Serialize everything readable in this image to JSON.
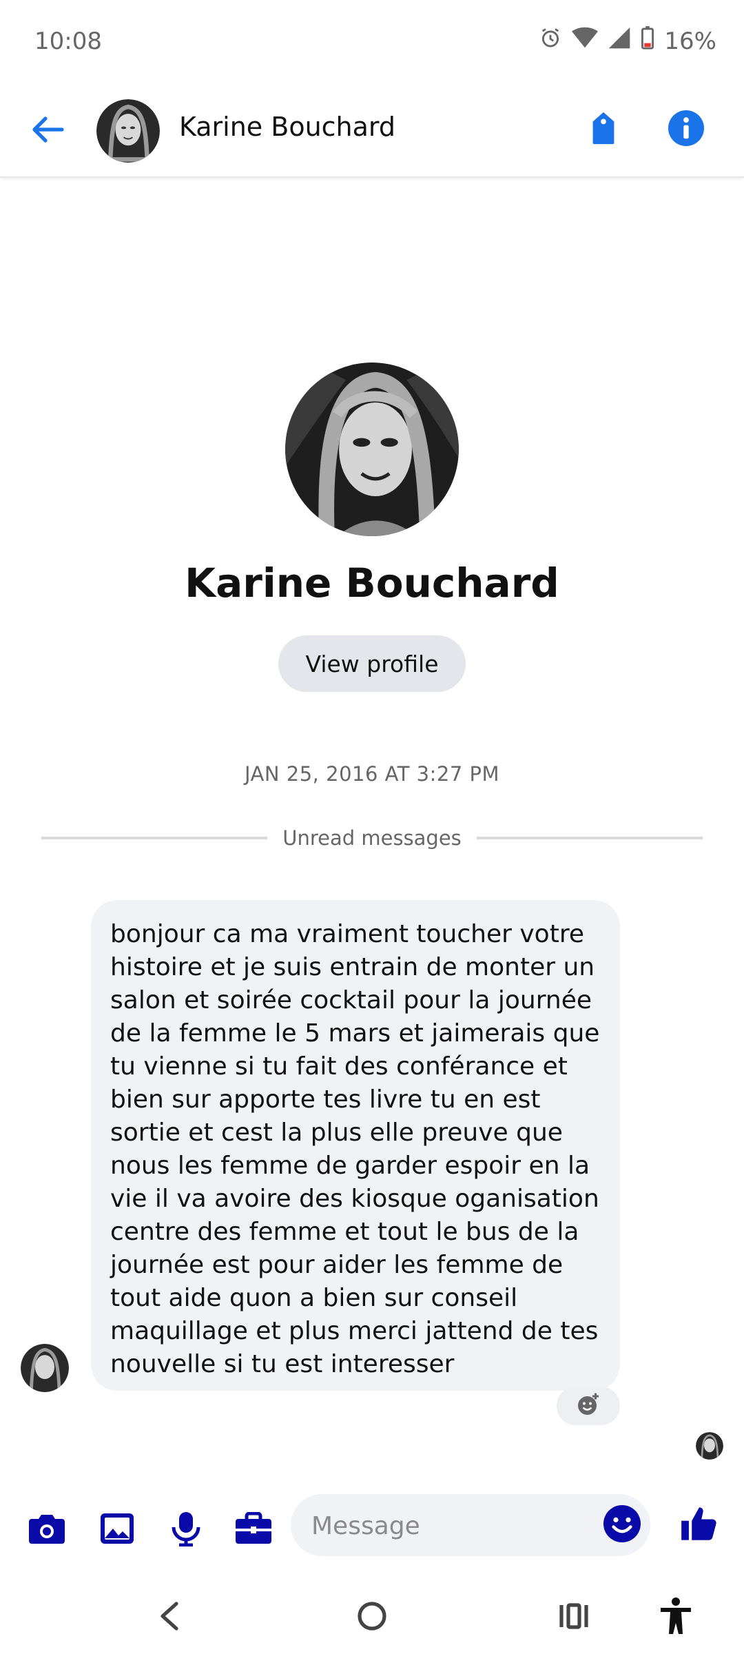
{
  "status": {
    "time": "10:08",
    "battery": "16%"
  },
  "header": {
    "name": "Karine Bouchard"
  },
  "profile": {
    "name": "Karine Bouchard",
    "view_profile_label": "View profile"
  },
  "conversation": {
    "date_label": "JAN 25, 2016 AT 3:27 PM",
    "unread_label": "Unread messages",
    "message": "bonjour ca ma  vraiment toucher votre\nhistoire et je suis entrain de monter un\nsalon et soirée cocktail pour la journée\nde la femme le 5 mars et jaimerais que\ntu vienne  si tu fait des conférance et\nbien sur  apporte tes livre tu  en est\nsortie et cest la plus elle preuve  que\nnous les femme de garder espoir en la\nvie il va avoire  des kiosque oganisation\ncentre des femme et tout le bus de la\njournée est pour aider les femme de\ntout aide quon a bien sur conseil\nmaquillage  et plus merci jattend de tes\nnouvelle si tu est interesser"
  },
  "composer": {
    "placeholder": "Message"
  },
  "colors": {
    "accent": "#1a73e8",
    "composer_icon": "#0a0aa8",
    "bubble_bg": "#f1f2f6"
  },
  "icons": {
    "back": "arrow-left-icon",
    "tag": "tag-icon",
    "info": "info-icon",
    "camera": "camera-icon",
    "gallery": "image-icon",
    "mic": "microphone-icon",
    "briefcase": "briefcase-icon",
    "emoji": "emoji-icon",
    "like": "thumbs-up-icon"
  }
}
